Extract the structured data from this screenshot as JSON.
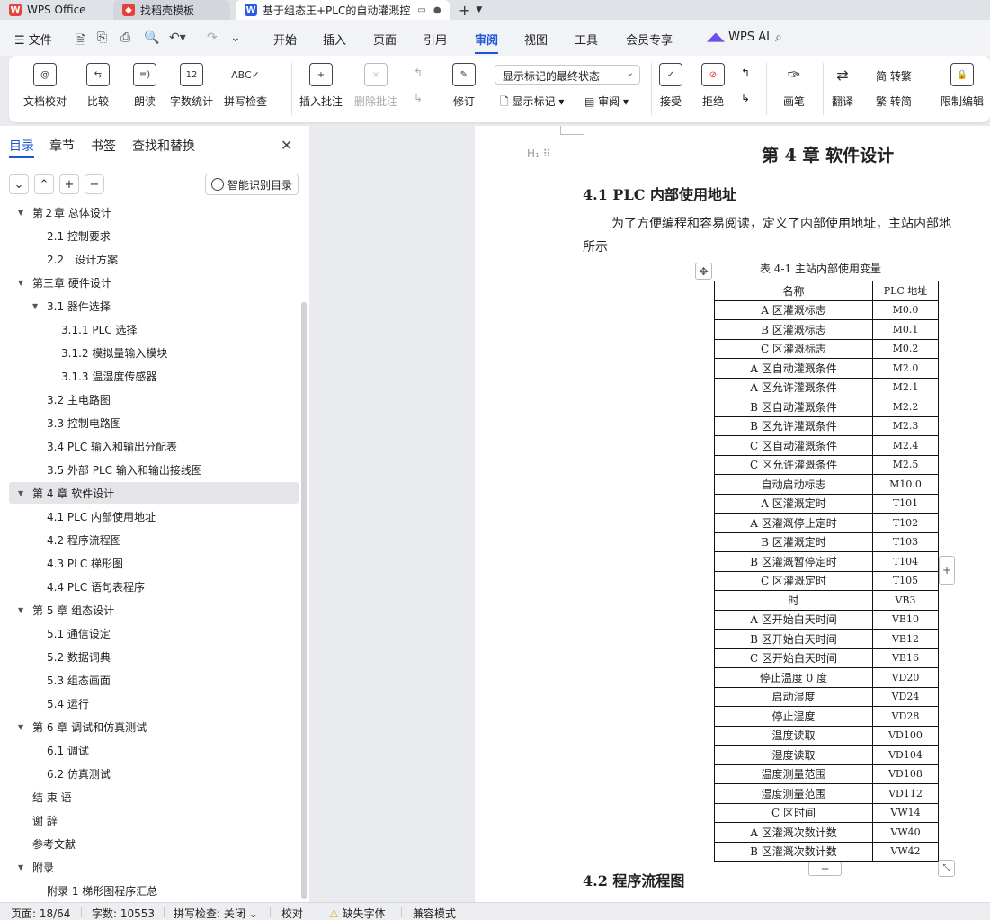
{
  "tabs": [
    {
      "label": "WPS Office",
      "icon": "wps-logo-icon"
    },
    {
      "label": "找稻壳模板",
      "icon": "docer-icon"
    },
    {
      "label": "基于组态王+PLC的自动灌溉控",
      "icon": "word-doc-icon",
      "active": true
    }
  ],
  "menu": {
    "file": "文件",
    "items": [
      "开始",
      "插入",
      "页面",
      "引用",
      "审阅",
      "视图",
      "工具",
      "会员专享"
    ],
    "active": "审阅",
    "ai": "WPS AI"
  },
  "ribbon": {
    "doc_check": "文档校对",
    "compare": "比较",
    "read_aloud": "朗读",
    "word_count": "字数统计",
    "spell_check": "拼写检查",
    "insert_comment": "插入批注",
    "delete_comment": "删除批注",
    "revise": "修订",
    "markup_dropdown": "显示标记的最终状态",
    "show_markup": "显示标记",
    "review_pane": "审阅",
    "accept": "接受",
    "reject": "拒绝",
    "pen": "画笔",
    "translate": "翻译",
    "to_trad": "简 转繁",
    "to_simp": "繁 转简",
    "restrict_edit": "限制编辑"
  },
  "nav": {
    "tabs": [
      "目录",
      "章节",
      "书签",
      "查找和替换"
    ],
    "active_tab": "目录",
    "smart_toc": "智能识别目录",
    "items": [
      {
        "text": "第２章 总体设计",
        "level": 1,
        "arrow": "▼"
      },
      {
        "text": "2.1 控制要求",
        "level": 2
      },
      {
        "text": "2.2　设计方案",
        "level": 2
      },
      {
        "text": "第三章 硬件设计",
        "level": 1,
        "arrow": "▼"
      },
      {
        "text": "3.1 器件选择",
        "level": 2,
        "arrow": "▼"
      },
      {
        "text": "3.1.1 PLC 选择",
        "level": 3
      },
      {
        "text": "3.1.2 模拟量输入模块",
        "level": 3
      },
      {
        "text": "3.1.3 温湿度传感器",
        "level": 3
      },
      {
        "text": "3.2 主电路图",
        "level": 2
      },
      {
        "text": "3.3 控制电路图",
        "level": 2
      },
      {
        "text": "3.4 PLC 输入和输出分配表",
        "level": 2
      },
      {
        "text": "3.5 外部 PLC 输入和输出接线图",
        "level": 2
      },
      {
        "text": "第 4 章 软件设计",
        "level": 1,
        "arrow": "▼",
        "selected": true
      },
      {
        "text": "4.1 PLC 内部使用地址",
        "level": 2
      },
      {
        "text": "4.2 程序流程图",
        "level": 2
      },
      {
        "text": "4.3 PLC 梯形图",
        "level": 2
      },
      {
        "text": "4.4 PLC 语句表程序",
        "level": 2
      },
      {
        "text": "第 5 章 组态设计",
        "level": 1,
        "arrow": "▼"
      },
      {
        "text": "5.1 通信设定",
        "level": 2
      },
      {
        "text": "5.2 数据词典",
        "level": 2
      },
      {
        "text": "5.3 组态画面",
        "level": 2
      },
      {
        "text": "5.4 运行",
        "level": 2
      },
      {
        "text": "第 6 章 调试和仿真测试",
        "level": 1,
        "arrow": "▼"
      },
      {
        "text": "6.1 调试",
        "level": 2
      },
      {
        "text": "6.2 仿真测试",
        "level": 2
      },
      {
        "text": "结 束 语",
        "level": 1
      },
      {
        "text": "谢 辞",
        "level": 1
      },
      {
        "text": "参考文献",
        "level": 1
      },
      {
        "text": "附录",
        "level": 1,
        "arrow": "▼"
      },
      {
        "text": "附录 1 梯形图程序汇总",
        "level": 2
      }
    ]
  },
  "doc": {
    "heading_marker": "H₁",
    "chapter_title": "第 4 章 软件设计",
    "section_41": "4.1 PLC 内部使用地址",
    "para_line1": "为了方便编程和容易阅读，定义了内部使用地址，主站内部地",
    "para_line2": "所示",
    "table_caption": "表 4-1 主站内部使用变量",
    "table_headers": [
      "名称",
      "PLC 地址"
    ],
    "table_rows": [
      [
        "A 区灌溉标志",
        "M0.0"
      ],
      [
        "B 区灌溉标志",
        "M0.1"
      ],
      [
        "C 区灌溉标志",
        "M0.2"
      ],
      [
        "A 区自动灌溉条件",
        "M2.0"
      ],
      [
        "A 区允许灌溉条件",
        "M2.1"
      ],
      [
        "B 区自动灌溉条件",
        "M2.2"
      ],
      [
        "B 区允许灌溉条件",
        "M2.3"
      ],
      [
        "C 区自动灌溉条件",
        "M2.4"
      ],
      [
        "C 区允许灌溉条件",
        "M2.5"
      ],
      [
        "自动启动标志",
        "M10.0"
      ],
      [
        "A 区灌溉定时",
        "T101"
      ],
      [
        "A 区灌溉停止定时",
        "T102"
      ],
      [
        "B 区灌溉定时",
        "T103"
      ],
      [
        "B 区灌溉暂停定时",
        "T104"
      ],
      [
        "C 区灌溉定时",
        "T105"
      ],
      [
        "时",
        "VB3"
      ],
      [
        "A 区开始白天时间",
        "VB10"
      ],
      [
        "B 区开始白天时间",
        "VB12"
      ],
      [
        "C 区开始白天时间",
        "VB16"
      ],
      [
        "停止温度 0 度",
        "VD20"
      ],
      [
        "启动湿度",
        "VD24"
      ],
      [
        "停止湿度",
        "VD28"
      ],
      [
        "温度读取",
        "VD100"
      ],
      [
        "湿度读取",
        "VD104"
      ],
      [
        "温度测量范围",
        "VD108"
      ],
      [
        "湿度测量范围",
        "VD112"
      ],
      [
        "C 区时间",
        "VW14"
      ],
      [
        "A 区灌溉次数计数",
        "VW40"
      ],
      [
        "B 区灌溉次数计数",
        "VW42"
      ]
    ],
    "section_42": "4.2 程序流程图"
  },
  "status": {
    "page": "页面: 18/64",
    "words": "字数: 10553",
    "spell": "拼写检查: 关闭",
    "proof": "校对",
    "missing_font": "缺失字体",
    "compat": "兼容模式"
  },
  "colors": {
    "accent": "#1a56d6",
    "wps_red": "#e8413b",
    "word_blue": "#2b5ce6"
  }
}
